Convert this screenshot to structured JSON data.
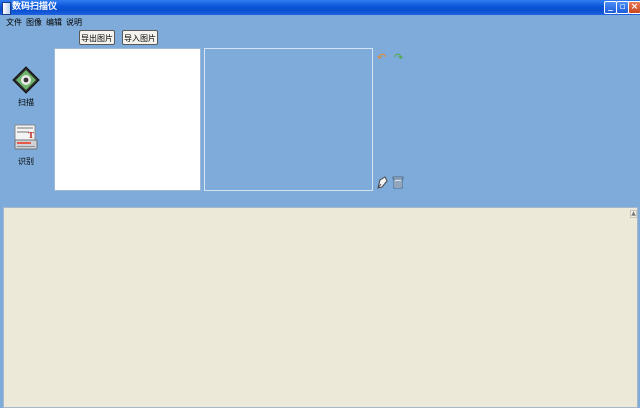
{
  "window": {
    "title": "数码扫描仪"
  },
  "menu": {
    "items": [
      "文件",
      "图像",
      "编辑",
      "说明"
    ]
  },
  "toolbar": {
    "export_label": "导出图片",
    "import_label": "导入图片"
  },
  "tools": {
    "scan_label": "扫描",
    "recognize_label": "识别"
  },
  "colors": {
    "background": "#7eabd9",
    "titlebar": "#0a54d8",
    "text_area": "#ece9d8"
  }
}
